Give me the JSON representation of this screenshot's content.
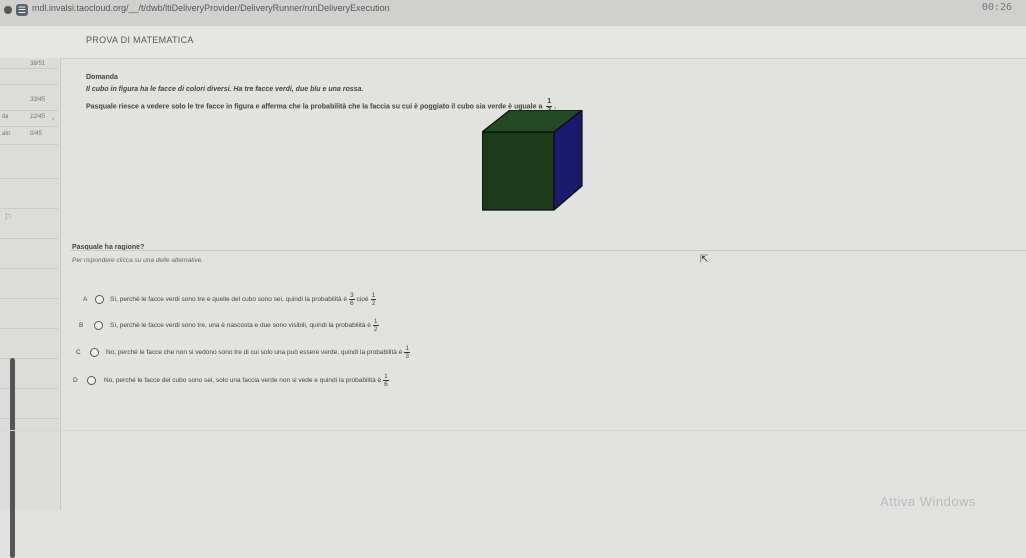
{
  "browser": {
    "url": "mdl.invalsi.taocloud.org/__/t/dwb/ltiDeliveryProvider/DeliveryRunner/runDeliveryExecution",
    "timer": "00:26"
  },
  "exam": {
    "title": "PROVA DI MATEMATICA"
  },
  "sidebar": {
    "rows": [
      {
        "label": "",
        "value": "38/51"
      },
      {
        "label": "",
        "value": "33/45"
      },
      {
        "label": "ita",
        "value": "12/45"
      },
      {
        "label": "ato",
        "value": "0/45"
      }
    ]
  },
  "question": {
    "label": "Domanda",
    "text1": "Il cubo in figura ha le facce di colori diversi. Ha tre facce verdi, due blu e una rossa.",
    "text2": "Pasquale riesce a vedere solo le tre facce in figura e afferma che la probabilità che la faccia su cui è poggiato il cubo sia verde è uguale a",
    "text2_frac": {
      "num": "1",
      "den": "2"
    },
    "prompt": "Pasquale ha ragione?",
    "hint": "Per rispondere clicca su una delle alternative.",
    "cube_colors": {
      "front": "#1a3a1a",
      "top": "#234a23",
      "side": "#1a1a6e"
    }
  },
  "options": [
    {
      "letter": "A",
      "text": "Sì, perché le facce verdi sono tre e quelle del cubo sono sei, quindi la probabilità è",
      "frac1": {
        "num": "3",
        "den": "6"
      },
      "mid": "cioè",
      "frac2": {
        "num": "1",
        "den": "2"
      }
    },
    {
      "letter": "B",
      "text": "Sì, perché le facce verdi sono tre, una è nascosta e due sono visibili, quindi la probabilità è",
      "frac1": {
        "num": "1",
        "den": "2"
      },
      "mid": "",
      "frac2": null
    },
    {
      "letter": "C",
      "text": "No, perché le facce che non si vedono sono tre di cui solo una può essere verde, quindi la probabilità è",
      "frac1": {
        "num": "1",
        "den": "3"
      },
      "mid": "",
      "frac2": null
    },
    {
      "letter": "D",
      "text": "No, perché le facce del cubo sono sei, solo una faccia verde non si vede e quindi la probabilità è",
      "frac1": {
        "num": "1",
        "den": "6"
      },
      "mid": "",
      "frac2": null
    }
  ],
  "watermark": "Attiva Windows"
}
